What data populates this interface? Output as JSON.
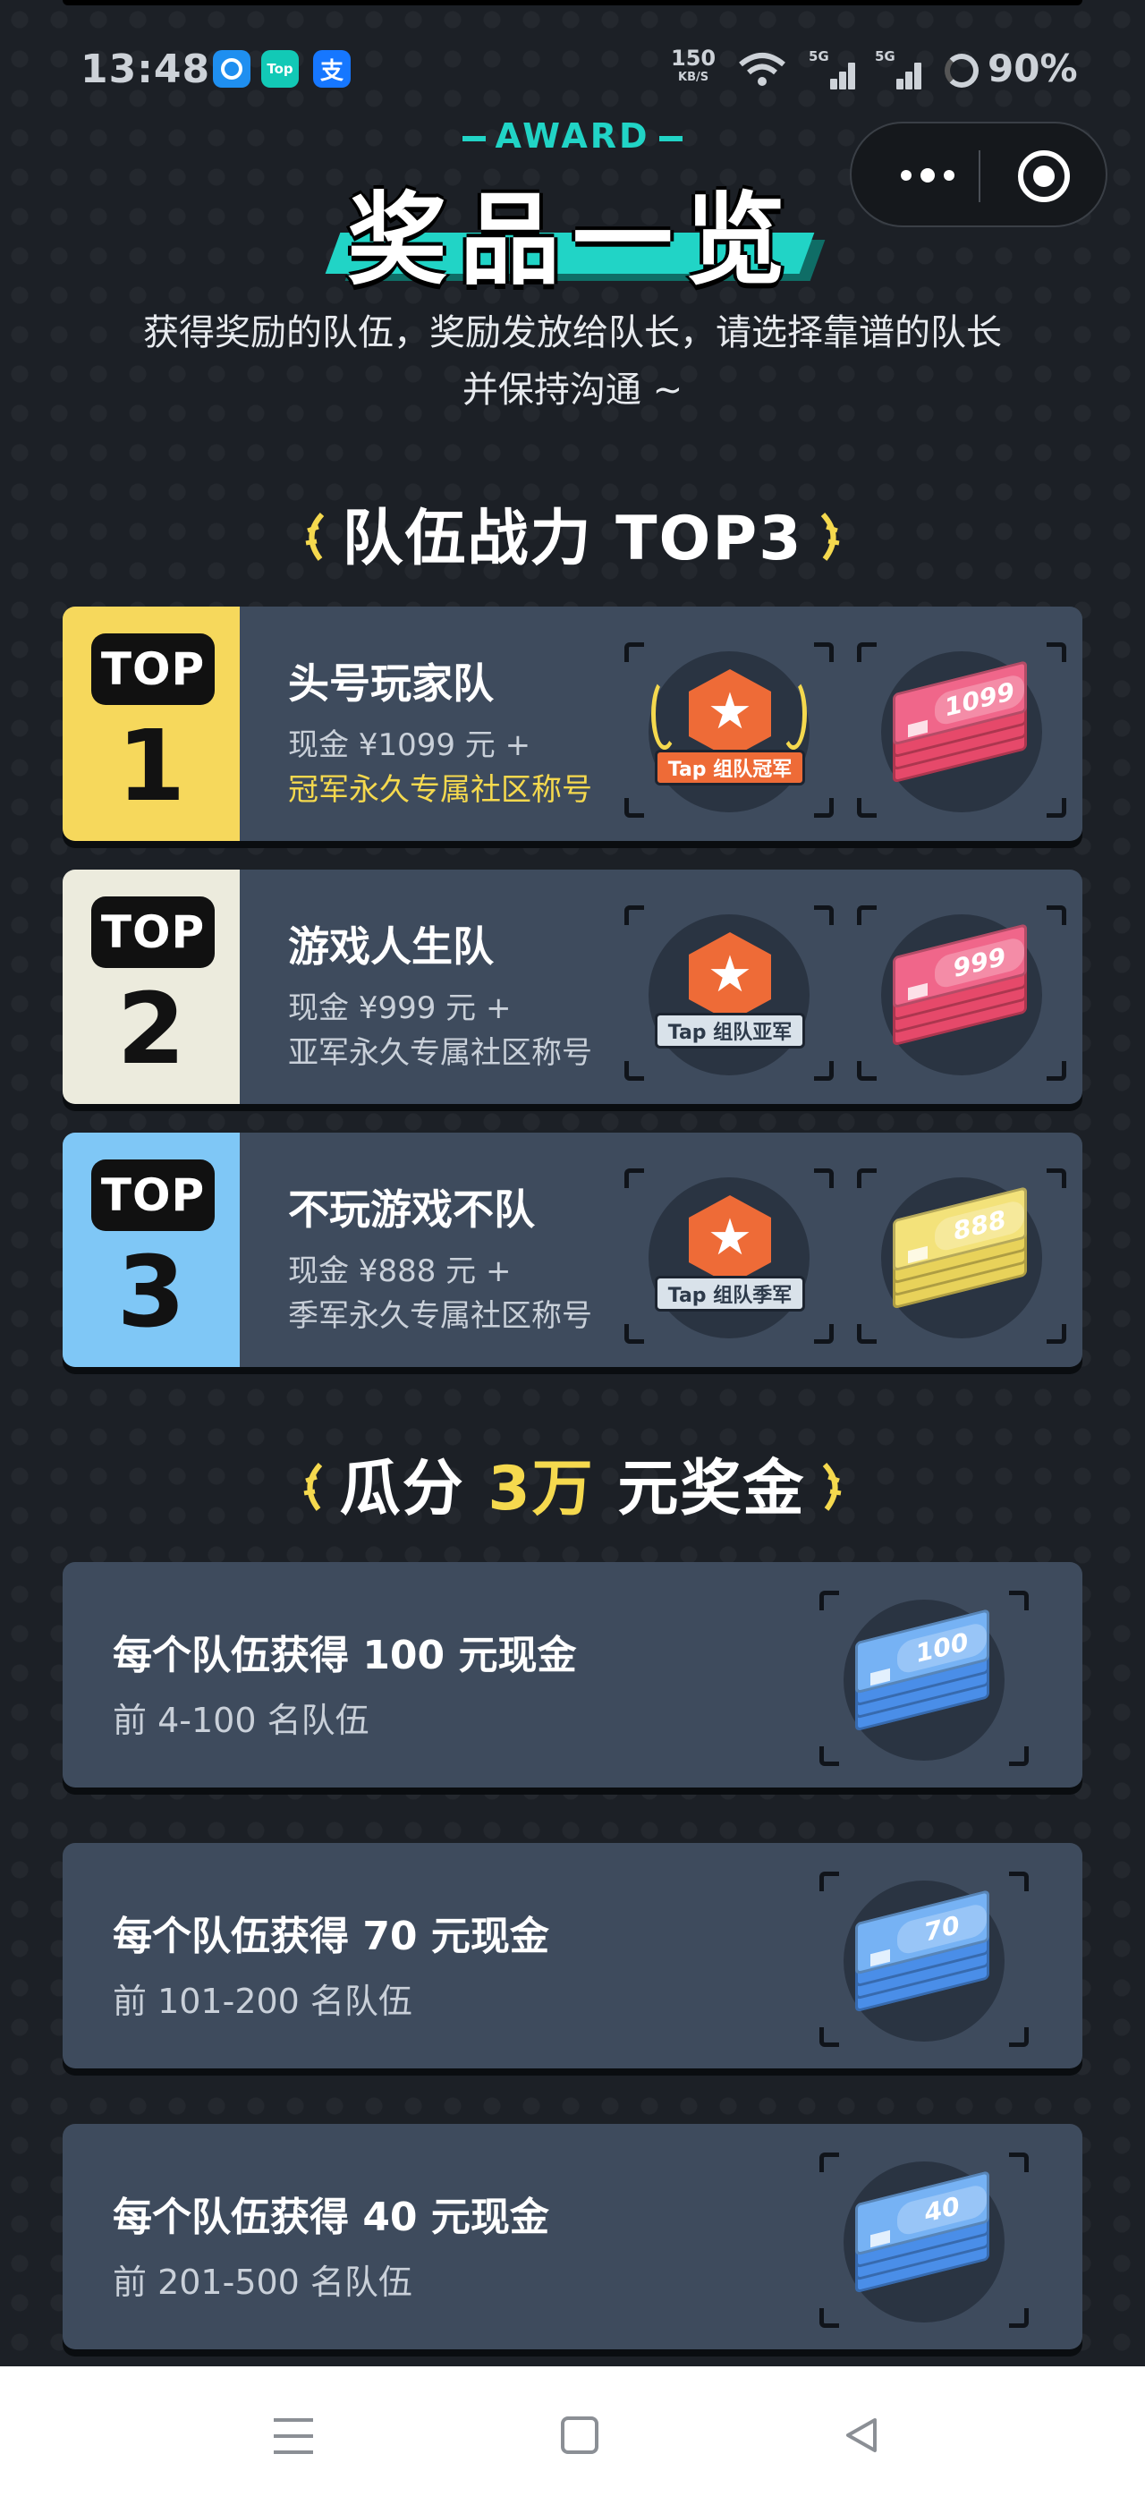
{
  "status_bar": {
    "time": "13:48",
    "net_speed": "150",
    "net_unit": "KB/S",
    "signal_1": "5G",
    "signal_2": "5G",
    "battery": "90%",
    "apps": [
      "app-icon-1",
      "Top",
      "支"
    ]
  },
  "header": {
    "subtitle": "AWARD",
    "title": "奖品一览",
    "intro": "获得奖励的队伍，奖励发放给队长，请选择靠谱的队长并保持沟通 ~"
  },
  "top3_section": {
    "heading": "队伍战力 TOP3",
    "teams": [
      {
        "badge": "TOP",
        "rank": "1",
        "name": "头号玩家队",
        "cash_line": "现金 ¥1099 元 +",
        "title_line": "冠军永久专属社区称号",
        "badge_label": "Tap 组队冠军",
        "cash_amount": "1099",
        "rank_color": "#f6d85c"
      },
      {
        "badge": "TOP",
        "rank": "2",
        "name": "游戏人生队",
        "cash_line": "现金 ¥999 元 +",
        "title_line": "亚军永久专属社区称号",
        "badge_label": "Tap 组队亚军",
        "cash_amount": "999",
        "rank_color": "#ecebdd"
      },
      {
        "badge": "TOP",
        "rank": "3",
        "name": "不玩游戏不队",
        "cash_line": "现金 ¥888 元 +",
        "title_line": "季军永久专属社区称号",
        "badge_label": "Tap 组队季军",
        "cash_amount": "888",
        "rank_color": "#7fc7f6"
      }
    ]
  },
  "pool_section": {
    "heading_pre": "瓜分",
    "heading_amount": "3万",
    "heading_post": "元奖金",
    "tiers": [
      {
        "title": "每个队伍获得 100 元现金",
        "range": "前 4-100 名队伍",
        "cash_amount": "100"
      },
      {
        "title": "每个队伍获得 70 元现金",
        "range": "前 101-200 名队伍",
        "cash_amount": "70"
      },
      {
        "title": "每个队伍获得 40 元现金",
        "range": "前 201-500 名队伍",
        "cash_amount": "40"
      }
    ]
  },
  "colors": {
    "accent_teal": "#21d4c6",
    "accent_gold": "#f5d94e",
    "card_bg": "#3e4b5d",
    "page_bg": "#1c2026"
  },
  "nav_bar": {
    "icons": [
      "menu-icon",
      "home-icon",
      "back-icon"
    ]
  }
}
